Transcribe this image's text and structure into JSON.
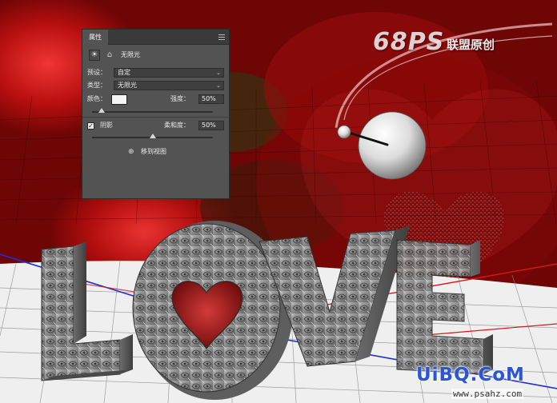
{
  "panel": {
    "tab_label": "属性",
    "light_type_title": "无限光",
    "preset_label": "预设：",
    "preset_value": "自定",
    "type_label": "类型：",
    "type_value": "无限光",
    "color_label": "颜色：",
    "light_color": "#f4f4f4",
    "intensity_label": "强度：",
    "intensity_value": "50%",
    "intensity_level": 0.08,
    "shadow_label": "阴影",
    "shadow_checked": true,
    "softness_label": "柔和度：",
    "softness_value": "50%",
    "softness_level": 0.5,
    "move_to_view_label": "移到视图"
  },
  "artwork": {
    "letters": [
      "L",
      "O",
      "V",
      "E"
    ]
  },
  "watermarks": {
    "top_logo": "68PS",
    "top_text": "联盟原创",
    "bottom_logo": "UiBQ.CoM",
    "bottom_url": "www.psahz.com"
  },
  "colors": {
    "background_red": "#8a0a0a",
    "panel_bg": "#535353",
    "panel_tab_bar": "#3a3a3a",
    "letter_stone": "#8c8c8c",
    "bottom_logo": "#2b54d6"
  }
}
